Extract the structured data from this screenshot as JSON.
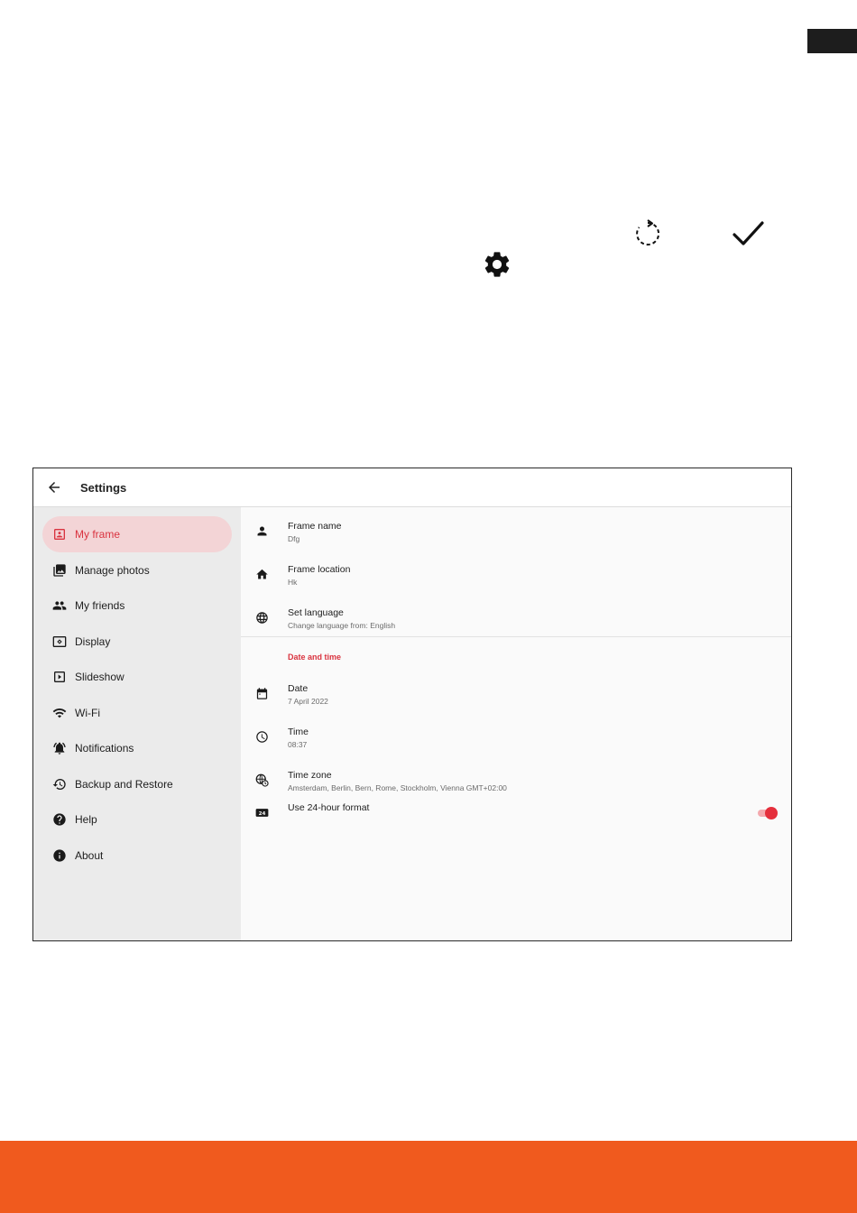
{
  "colors": {
    "accent": "#d9333f",
    "toggle_on": "#e52f3c",
    "footer": "#f05a1e",
    "active_nav_bg": "#f3d4d6"
  },
  "doc_icons": [
    "refresh-icon",
    "check-icon",
    "gear-icon"
  ],
  "appbar": {
    "title": "Settings"
  },
  "sidebar": {
    "items": [
      {
        "label": "My frame",
        "icon": "portrait-icon",
        "active": true
      },
      {
        "label": "Manage photos",
        "icon": "photo-library-icon"
      },
      {
        "label": "My friends",
        "icon": "people-icon"
      },
      {
        "label": "Display",
        "icon": "display-icon"
      },
      {
        "label": "Slideshow",
        "icon": "slideshow-icon"
      },
      {
        "label": "Wi-Fi",
        "icon": "wifi-icon"
      },
      {
        "label": "Notifications",
        "icon": "bell-icon"
      },
      {
        "label": "Backup and Restore",
        "icon": "restore-icon"
      },
      {
        "label": "Help",
        "icon": "help-icon"
      },
      {
        "label": "About",
        "icon": "info-icon"
      }
    ]
  },
  "content": {
    "frame_name": {
      "title": "Frame name",
      "value": "Dfg",
      "icon": "person-icon"
    },
    "frame_location": {
      "title": "Frame location",
      "value": "Hk",
      "icon": "home-icon"
    },
    "language": {
      "title": "Set language",
      "value": "Change language from: English",
      "icon": "globe-icon"
    },
    "section_date_time": "Date and time",
    "date": {
      "title": "Date",
      "value": "7 April 2022",
      "icon": "calendar-icon"
    },
    "time": {
      "title": "Time",
      "value": "08:37",
      "icon": "clock-icon"
    },
    "timezone": {
      "title": "Time zone",
      "value": "Amsterdam, Berlin, Bern, Rome, Stockholm, Vienna GMT+02:00",
      "icon": "globe-clock-icon"
    },
    "hour24": {
      "title": "Use 24-hour format",
      "icon": "24h-icon",
      "enabled": true
    }
  }
}
